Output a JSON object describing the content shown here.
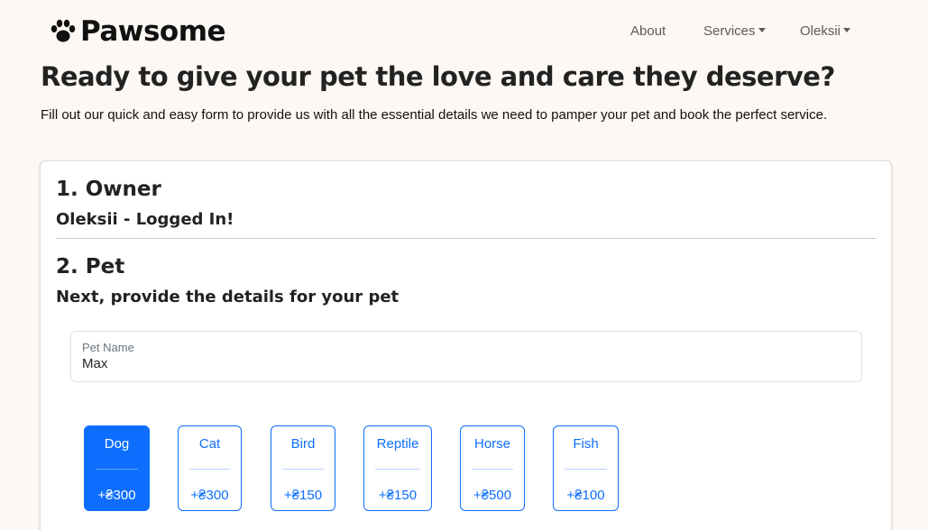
{
  "brand": {
    "name": "Pawsome",
    "icon": "paw-icon"
  },
  "nav": {
    "about": "About",
    "services": "Services",
    "user": "Oleksii"
  },
  "hero": {
    "title": "Ready to give your pet the love and care they deserve?",
    "lead": "Fill out our quick and easy form to provide us with all the essential details we need to pamper your pet and book the perfect service."
  },
  "owner": {
    "title": "1. Owner",
    "status": "Oleksii - Logged In!"
  },
  "pet": {
    "title": "2. Pet",
    "subtitle": "Next, provide the details for your pet",
    "name_label": "Pet Name",
    "name_value": "Max",
    "species": [
      {
        "name": "Dog",
        "price": "+₴300",
        "selected": true
      },
      {
        "name": "Cat",
        "price": "+₴300",
        "selected": false
      },
      {
        "name": "Bird",
        "price": "+₴150",
        "selected": false
      },
      {
        "name": "Reptile",
        "price": "+₴150",
        "selected": false
      },
      {
        "name": "Horse",
        "price": "+₴500",
        "selected": false
      },
      {
        "name": "Fish",
        "price": "+₴100",
        "selected": false
      }
    ]
  },
  "colors": {
    "accent": "#0d6efd",
    "background": "#fdf8f3"
  }
}
